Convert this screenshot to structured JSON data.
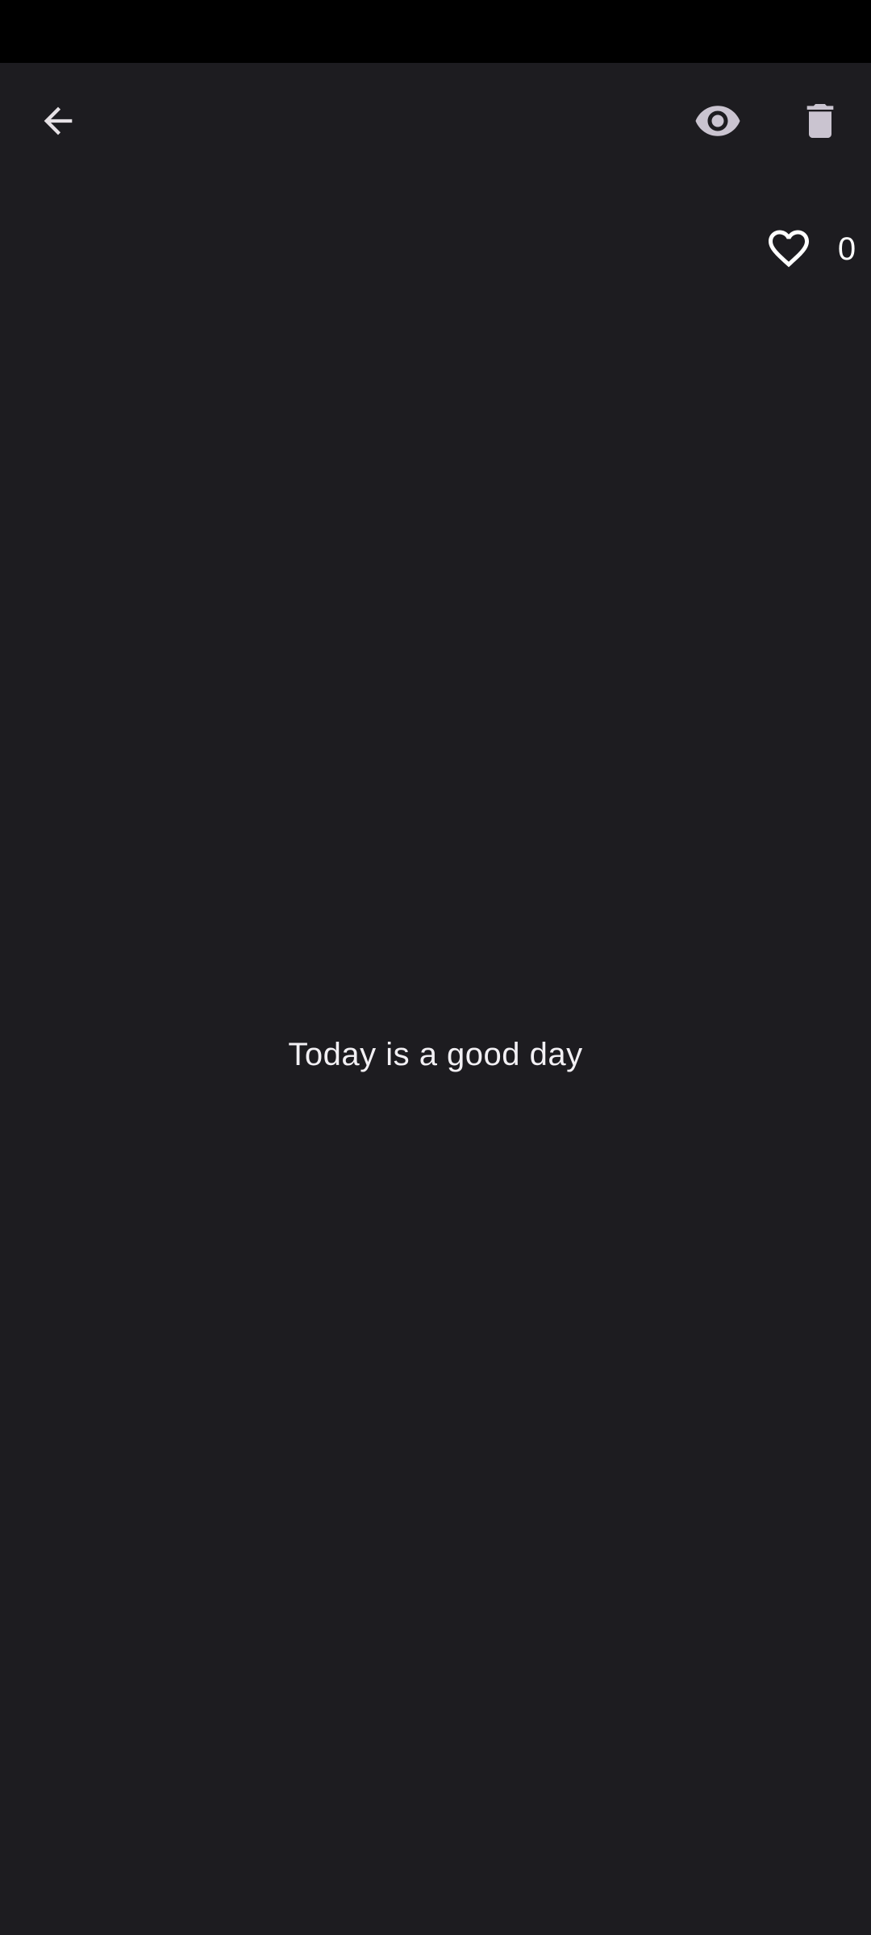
{
  "colors": {
    "background": "#1d1c20",
    "status_bar": "#000000",
    "icon_tint": "#cac4d0",
    "text": "#f2f0f4"
  },
  "toolbar": {
    "back_icon": "arrow-back-icon",
    "visibility_icon": "eye-icon",
    "delete_icon": "trash-icon"
  },
  "likes": {
    "icon": "heart-outline-icon",
    "count": "0"
  },
  "content": {
    "message": "Today is a good day"
  }
}
